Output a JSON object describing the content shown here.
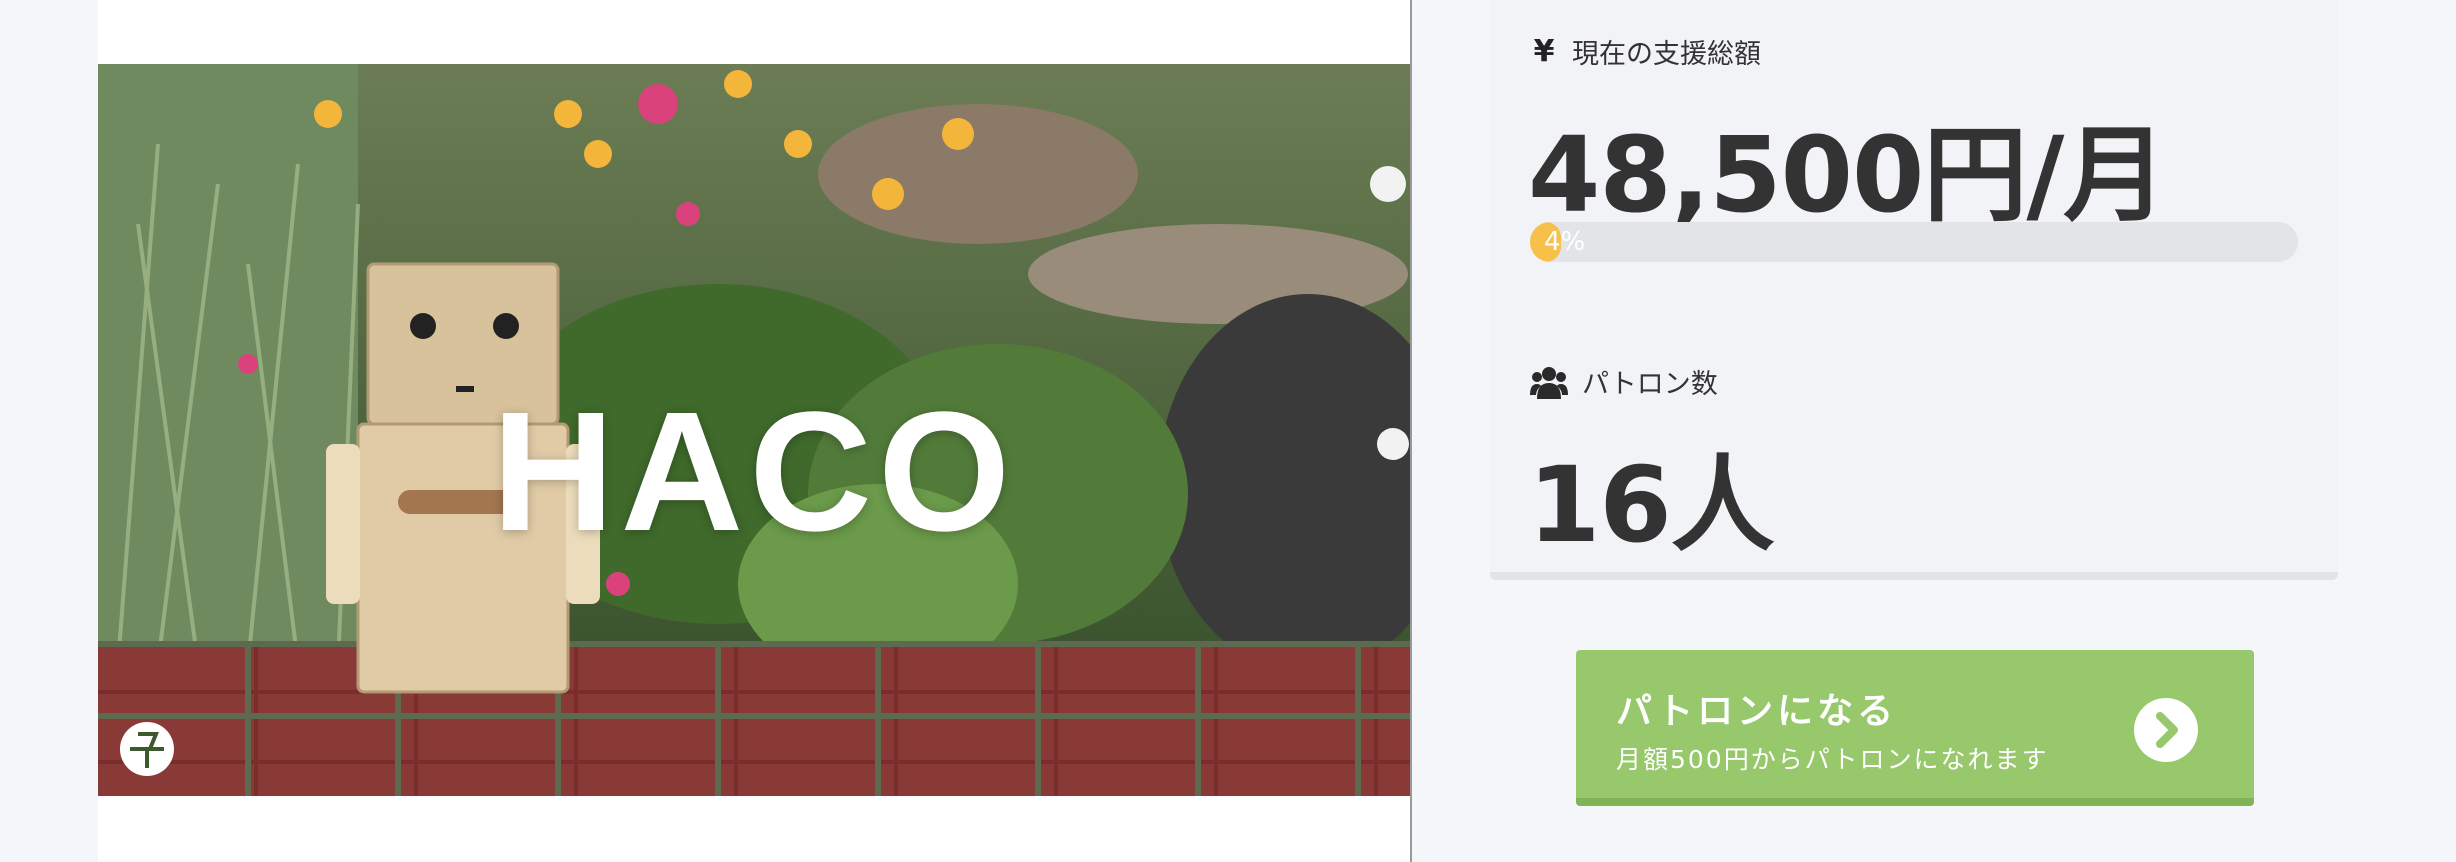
{
  "hero": {
    "title": "HACO"
  },
  "funding": {
    "label": "現在の支援総額",
    "icon": "yen-icon",
    "icon_glyph": "¥",
    "amount": "48,500円/月",
    "progress_percent": 4,
    "progress_label": "4%",
    "progress_color": "#f7c04a"
  },
  "patrons": {
    "label": "パトロン数",
    "icon": "users-icon",
    "count": "16人"
  },
  "cta": {
    "title": "パトロンになる",
    "subtitle": "月額500円からパトロンになれます",
    "icon": "chevron-right-icon",
    "color": "#97c86b"
  }
}
